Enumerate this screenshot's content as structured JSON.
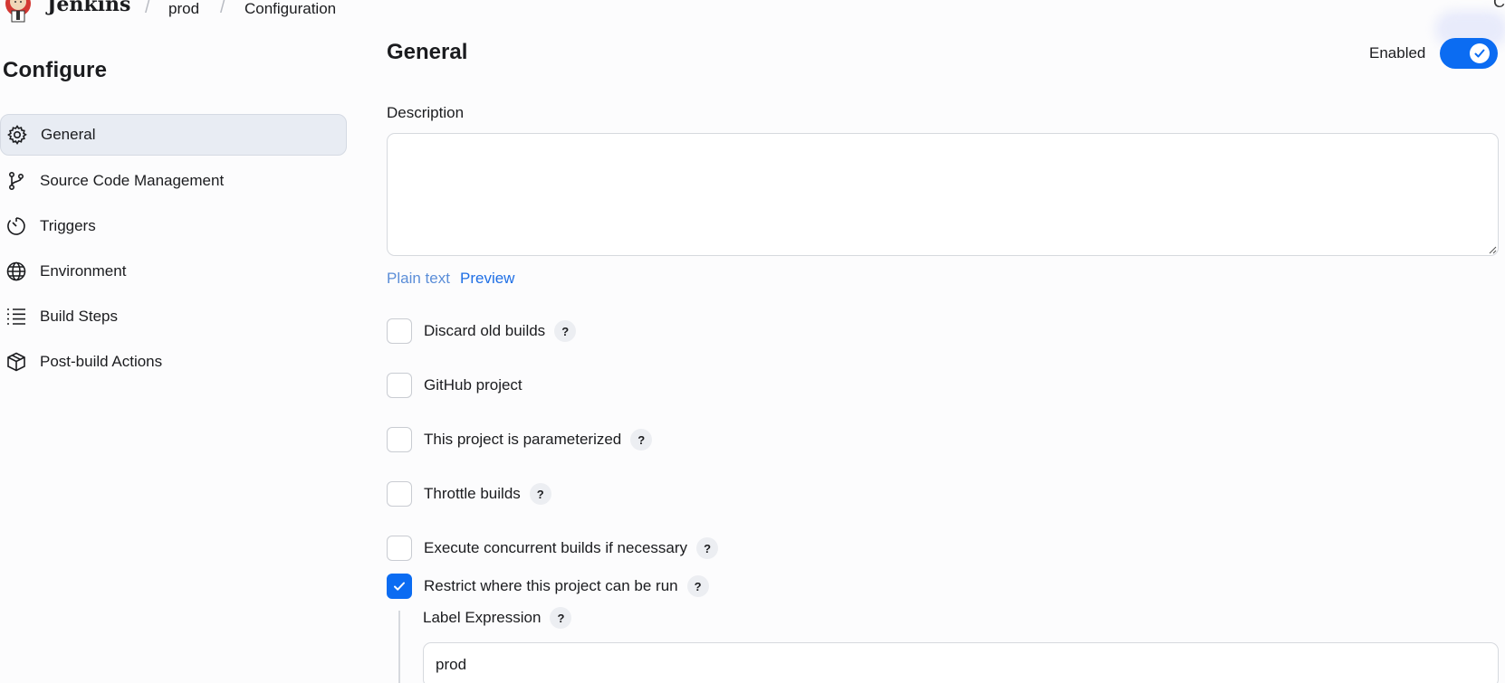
{
  "header": {
    "brand": "Jenkins",
    "breadcrumbs": [
      "prod",
      "Configuration"
    ],
    "corner_glyph": "C"
  },
  "sidebar": {
    "title": "Configure",
    "items": [
      {
        "label": "General",
        "icon": "gear-icon",
        "active": true
      },
      {
        "label": "Source Code Management",
        "icon": "git-branch-icon"
      },
      {
        "label": "Triggers",
        "icon": "timer-icon"
      },
      {
        "label": "Environment",
        "icon": "globe-icon"
      },
      {
        "label": "Build Steps",
        "icon": "list-icon"
      },
      {
        "label": "Post-build Actions",
        "icon": "package-icon"
      }
    ]
  },
  "main": {
    "title": "General",
    "enabled_label": "Enabled",
    "enabled": true,
    "description_label": "Description",
    "description_value": "",
    "plain_text_link": "Plain text",
    "preview_link": "Preview",
    "options": [
      {
        "label": "Discard old builds",
        "checked": false,
        "help": true
      },
      {
        "label": "GitHub project",
        "checked": false,
        "help": false
      },
      {
        "label": "This project is parameterized",
        "checked": false,
        "help": true
      },
      {
        "label": "Throttle builds",
        "checked": false,
        "help": true
      },
      {
        "label": "Execute concurrent builds if necessary",
        "checked": false,
        "help": true
      },
      {
        "label": "Restrict where this project can be run",
        "checked": true,
        "help": true
      }
    ],
    "label_expression": {
      "label": "Label Expression",
      "value": "prod"
    },
    "help_glyph": "?"
  },
  "colors": {
    "accent": "#0b6cf2",
    "sidebar_active_bg": "#e8ecf3",
    "link": "#1f6fe5"
  }
}
